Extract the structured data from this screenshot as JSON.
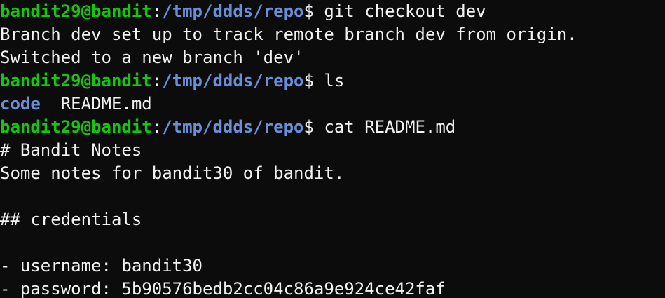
{
  "terminal": {
    "lines": [
      {
        "type": "prompt",
        "user": "bandit29@bandit",
        "sep": ":",
        "path": "/tmp/ddds/repo",
        "dollar": "$ ",
        "command": "git checkout dev"
      },
      {
        "type": "output",
        "text": "Branch dev set up to track remote branch dev from origin."
      },
      {
        "type": "output",
        "text": "Switched to a new branch 'dev'"
      },
      {
        "type": "prompt",
        "user": "bandit29@bandit",
        "sep": ":",
        "path": "/tmp/ddds/repo",
        "dollar": "$ ",
        "command": "ls"
      },
      {
        "type": "ls",
        "dir": "code",
        "gap": "  ",
        "file": "README.md"
      },
      {
        "type": "prompt",
        "user": "bandit29@bandit",
        "sep": ":",
        "path": "/tmp/ddds/repo",
        "dollar": "$ ",
        "command": "cat README.md"
      },
      {
        "type": "output",
        "text": "# Bandit Notes"
      },
      {
        "type": "output",
        "text": "Some notes for bandit30 of bandit."
      },
      {
        "type": "output",
        "text": ""
      },
      {
        "type": "output",
        "text": "## credentials"
      },
      {
        "type": "output",
        "text": ""
      },
      {
        "type": "output",
        "text": "- username: bandit30"
      },
      {
        "type": "output",
        "text": "- password: 5b90576bedb2cc04c86a9e924ce42faf"
      }
    ]
  },
  "colors": {
    "background": "#0c0c0c",
    "foreground": "#f2f2f2",
    "user": "#16c60c",
    "path": "#6a8ed8"
  }
}
